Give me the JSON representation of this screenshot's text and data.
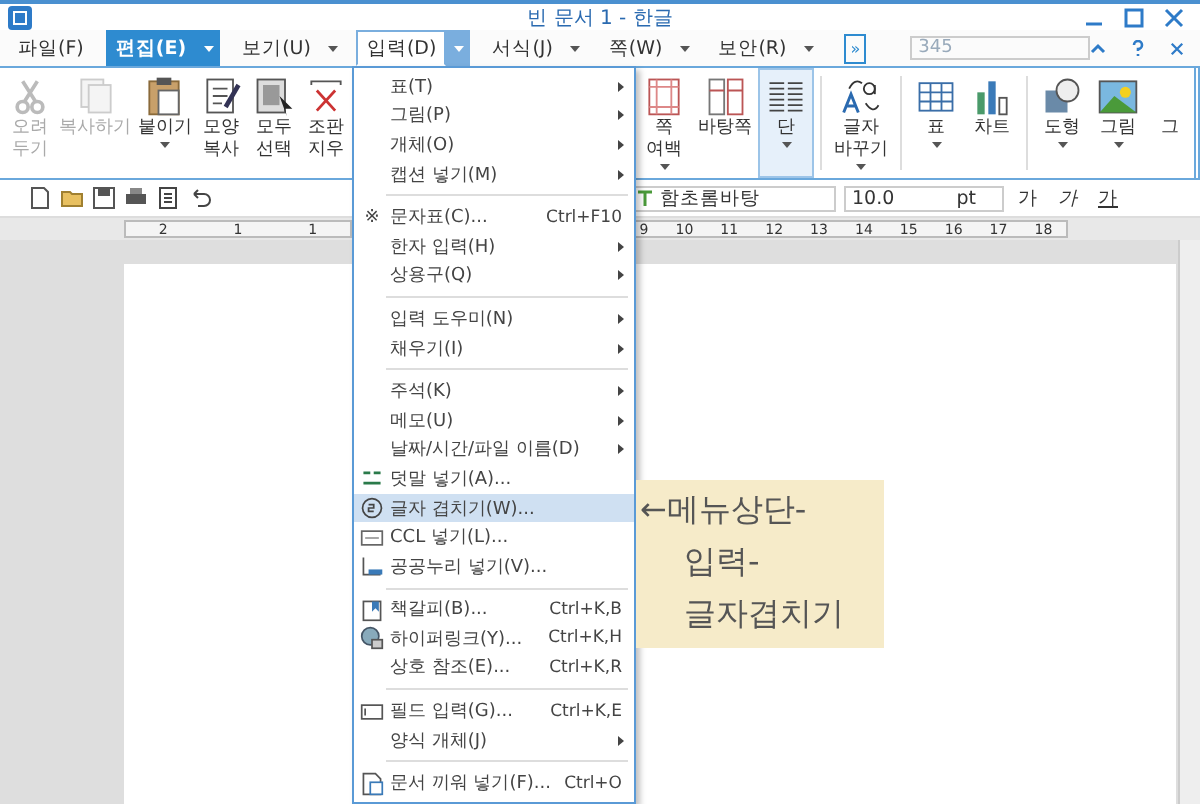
{
  "window": {
    "title": "빈 문서 1 - 한글"
  },
  "menu_tabs": [
    {
      "label": "파일(F)",
      "selected": false,
      "open": false,
      "caret": false
    },
    {
      "label": "편집(E)",
      "selected": true,
      "open": false,
      "caret": true
    },
    {
      "label": "보기(U)",
      "selected": false,
      "open": false,
      "caret": true
    },
    {
      "label": "입력(D)",
      "selected": false,
      "open": true,
      "caret": true
    },
    {
      "label": "서식(J)",
      "selected": false,
      "open": false,
      "caret": true
    },
    {
      "label": "쪽(W)",
      "selected": false,
      "open": false,
      "caret": true
    },
    {
      "label": "보안(R)",
      "selected": false,
      "open": false,
      "caret": true
    }
  ],
  "more_button": "»",
  "find_field": {
    "value": "345"
  },
  "ribbon_left": [
    {
      "label": "오려\n두기",
      "disabled": true,
      "caret": false
    },
    {
      "label": "복사하기",
      "disabled": true,
      "caret": false
    },
    {
      "label": "붙이기",
      "disabled": false,
      "caret": true
    },
    {
      "label": "모양\n복사",
      "disabled": false,
      "caret": false
    },
    {
      "label": "모두\n선택",
      "disabled": false,
      "caret": false
    },
    {
      "label": "조판\n지우",
      "disabled": false,
      "caret": false
    }
  ],
  "ribbon_right": [
    {
      "label": "쪽\n여백",
      "selected": false,
      "caret": true
    },
    {
      "label": "바탕쪽",
      "selected": false,
      "caret": false
    },
    {
      "label": "단",
      "selected": true,
      "caret": true
    },
    {
      "label": "글자\n바꾸기",
      "selected": false,
      "caret": true
    },
    {
      "label": "표",
      "selected": false,
      "caret": true
    },
    {
      "label": "차트",
      "selected": false,
      "caret": false
    },
    {
      "label": "도형",
      "selected": false,
      "caret": true
    },
    {
      "label": "그림",
      "selected": false,
      "caret": true
    },
    {
      "label": "그",
      "selected": false,
      "caret": false
    }
  ],
  "format_bar": {
    "font": "함초롬바탕",
    "size": "10.0",
    "unit": "pt",
    "styles": [
      "가",
      "가",
      "가"
    ]
  },
  "ruler": {
    "left_numbers": [
      "2",
      "1",
      "1"
    ],
    "right_numbers": [
      "9",
      "10",
      "11",
      "12",
      "13",
      "14",
      "15",
      "16",
      "17",
      "18"
    ]
  },
  "input_menu": [
    {
      "kind": "item",
      "label": "표(T)",
      "submenu": true,
      "selected": false
    },
    {
      "kind": "item",
      "label": "그림(P)",
      "submenu": true,
      "selected": false
    },
    {
      "kind": "item",
      "label": "개체(O)",
      "submenu": true,
      "selected": false
    },
    {
      "kind": "item",
      "label": "캡션 넣기(M)",
      "submenu": true,
      "selected": false
    },
    {
      "kind": "separator"
    },
    {
      "kind": "item",
      "glyph": "※",
      "label": "문자표(C)...",
      "shortcut": "Ctrl+F10",
      "submenu": false,
      "selected": false
    },
    {
      "kind": "item",
      "label": "한자 입력(H)",
      "submenu": true,
      "selected": false
    },
    {
      "kind": "item",
      "label": "상용구(Q)",
      "submenu": true,
      "selected": false
    },
    {
      "kind": "separator"
    },
    {
      "kind": "item",
      "label": "입력 도우미(N)",
      "submenu": true,
      "selected": false
    },
    {
      "kind": "item",
      "label": "채우기(I)",
      "submenu": true,
      "selected": false
    },
    {
      "kind": "separator"
    },
    {
      "kind": "item",
      "label": "주석(K)",
      "submenu": true,
      "selected": false
    },
    {
      "kind": "item",
      "label": "메모(U)",
      "submenu": true,
      "selected": false
    },
    {
      "kind": "item",
      "label": "날짜/시간/파일 이름(D)",
      "submenu": true,
      "selected": false
    },
    {
      "kind": "item",
      "label": "덧말 넣기(A)...",
      "submenu": false,
      "selected": false
    },
    {
      "kind": "item",
      "label": "글자 겹치기(W)...",
      "submenu": false,
      "selected": true
    },
    {
      "kind": "item",
      "label": "CCL 넣기(L)...",
      "submenu": false,
      "selected": false
    },
    {
      "kind": "item",
      "label": "공공누리 넣기(V)...",
      "submenu": false,
      "selected": false
    },
    {
      "kind": "separator"
    },
    {
      "kind": "item",
      "label": "책갈피(B)...",
      "shortcut": "Ctrl+K,B",
      "submenu": false,
      "selected": false
    },
    {
      "kind": "item",
      "label": "하이퍼링크(Y)...",
      "shortcut": "Ctrl+K,H",
      "submenu": false,
      "selected": false
    },
    {
      "kind": "item",
      "label": "상호 참조(E)...",
      "shortcut": "Ctrl+K,R",
      "submenu": false,
      "selected": false
    },
    {
      "kind": "separator"
    },
    {
      "kind": "item",
      "label": "필드 입력(G)...",
      "shortcut": "Ctrl+K,E",
      "submenu": false,
      "selected": false
    },
    {
      "kind": "item",
      "label": "양식 개체(J)",
      "submenu": true,
      "selected": false
    },
    {
      "kind": "separator"
    },
    {
      "kind": "item",
      "label": "문서 끼워 넣기(F)...",
      "shortcut": "Ctrl+O",
      "submenu": false,
      "selected": false
    }
  ],
  "annotation": {
    "text": "←메뉴상단-\n입력-\n글자겹치기"
  }
}
